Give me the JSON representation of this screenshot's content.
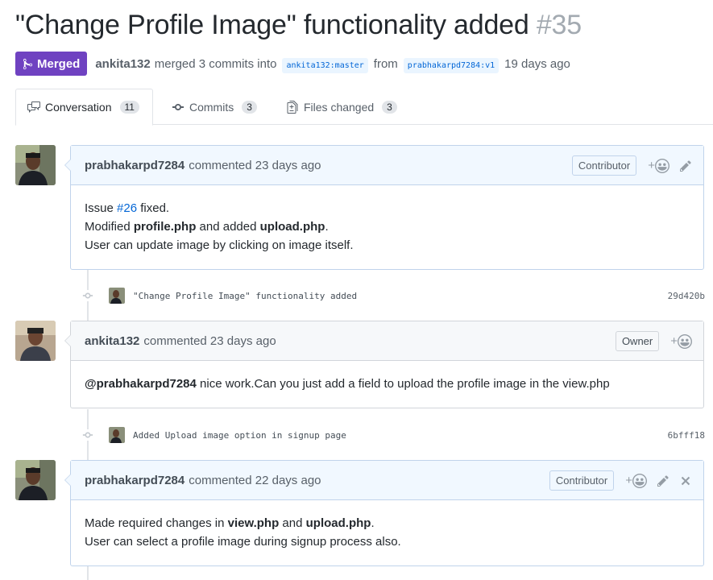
{
  "pr": {
    "title": "\"Change Profile Image\" functionality added",
    "number": "#35",
    "state_label": "Merged",
    "author": "ankita132",
    "merged_text": "merged 3 commits into",
    "base_branch": "ankita132:master",
    "from_text": "from",
    "head_branch": "prabhakarpd7284:v1",
    "time_ago": "19 days ago"
  },
  "tabs": [
    {
      "label": "Conversation",
      "count": "11",
      "icon": "comment-discussion-icon"
    },
    {
      "label": "Commits",
      "count": "3",
      "icon": "git-commit-icon"
    },
    {
      "label": "Files changed",
      "count": "3",
      "icon": "diff-icon"
    }
  ],
  "comments": [
    {
      "author": "prabhakarpd7284",
      "meta": "commented 23 days ago",
      "role": "Contributor",
      "body": {
        "line1_pre": "Issue ",
        "line1_link": "#26",
        "line1_post": " fixed.",
        "line2_a": "Modified ",
        "line2_b": "profile.php",
        "line2_c": " and added ",
        "line2_d": "upload.php",
        "line2_e": ".",
        "line3": "User can update image by clicking on image itself."
      }
    },
    {
      "author": "ankita132",
      "meta": "commented 23 days ago",
      "role": "Owner",
      "body": {
        "mention": "@prabhakarpd7284",
        "text": " nice work.Can you just add a field to upload the profile image in the view.php"
      }
    },
    {
      "author": "prabhakarpd7284",
      "meta": "commented 22 days ago",
      "role": "Contributor",
      "body": {
        "line1_a": "Made required changes in ",
        "line1_b": "view.php",
        "line1_c": " and ",
        "line1_d": "upload.php",
        "line1_e": ".",
        "line2": "User can select a profile image during signup process also."
      }
    }
  ],
  "commits": [
    {
      "message": "\"Change Profile Image\" functionality added",
      "sha": "29d420b"
    },
    {
      "message": "Added Upload image option in signup page",
      "sha": "6bfff18"
    }
  ],
  "reaction_plus": "+",
  "colors": {
    "merged": "#6f42c1",
    "link": "#0366d6",
    "contributor_header": "#f1f8ff",
    "owner_header": "#f6f8fa"
  }
}
